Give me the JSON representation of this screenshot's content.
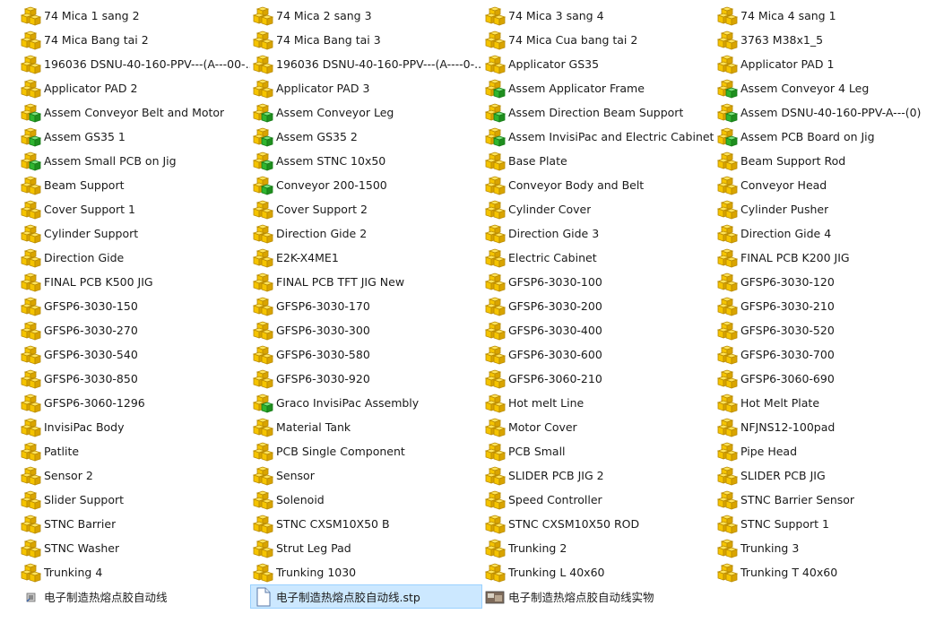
{
  "files": [
    {
      "name": "74 Mica 1 sang 2",
      "icon": "part-icon"
    },
    {
      "name": "74 Mica 2 sang 3",
      "icon": "part-icon"
    },
    {
      "name": "74 Mica 3 sang 4",
      "icon": "part-icon"
    },
    {
      "name": "74 Mica 4 sang 1",
      "icon": "part-icon"
    },
    {
      "name": "74 Mica Bang tai 2",
      "icon": "part-icon"
    },
    {
      "name": "74 Mica Bang tai 3",
      "icon": "part-icon"
    },
    {
      "name": "74 Mica Cua bang tai 2",
      "icon": "part-icon"
    },
    {
      "name": "3763 M38x1_5",
      "icon": "part-icon"
    },
    {
      "name": "196036 DSNU-40-160-PPV---(A---00-...",
      "icon": "part-icon"
    },
    {
      "name": "196036 DSNU-40-160-PPV---(A----0-...",
      "icon": "part-icon"
    },
    {
      "name": "Applicator GS35",
      "icon": "part-icon"
    },
    {
      "name": "Applicator PAD 1",
      "icon": "part-icon"
    },
    {
      "name": "Applicator PAD 2",
      "icon": "part-icon"
    },
    {
      "name": "Applicator PAD 3",
      "icon": "part-icon"
    },
    {
      "name": "Assem Applicator Frame",
      "icon": "assembly-icon"
    },
    {
      "name": "Assem Conveyor 4 Leg",
      "icon": "assembly-icon"
    },
    {
      "name": "Assem Conveyor Belt and Motor",
      "icon": "assembly-icon"
    },
    {
      "name": "Assem Conveyor Leg",
      "icon": "assembly-icon"
    },
    {
      "name": "Assem Direction Beam Support",
      "icon": "assembly-icon"
    },
    {
      "name": "Assem DSNU-40-160-PPV-A---(0)",
      "icon": "assembly-icon"
    },
    {
      "name": "Assem GS35 1",
      "icon": "assembly-icon"
    },
    {
      "name": "Assem GS35 2",
      "icon": "assembly-icon"
    },
    {
      "name": "Assem InvisiPac and Electric Cabinet",
      "icon": "assembly-icon"
    },
    {
      "name": "Assem PCB Board on Jig",
      "icon": "assembly-icon"
    },
    {
      "name": "Assem Small PCB on Jig",
      "icon": "assembly-icon"
    },
    {
      "name": "Assem STNC 10x50",
      "icon": "assembly-icon"
    },
    {
      "name": "Base Plate",
      "icon": "part-icon"
    },
    {
      "name": "Beam Support Rod",
      "icon": "part-icon"
    },
    {
      "name": "Beam Support",
      "icon": "part-icon"
    },
    {
      "name": "Conveyor 200-1500",
      "icon": "assembly-icon"
    },
    {
      "name": "Conveyor Body and Belt",
      "icon": "part-icon"
    },
    {
      "name": "Conveyor Head",
      "icon": "part-icon"
    },
    {
      "name": "Cover Support 1",
      "icon": "part-icon"
    },
    {
      "name": "Cover Support 2",
      "icon": "part-icon"
    },
    {
      "name": "Cylinder Cover",
      "icon": "part-icon"
    },
    {
      "name": "Cylinder Pusher",
      "icon": "part-icon"
    },
    {
      "name": "Cylinder Support",
      "icon": "part-icon"
    },
    {
      "name": "Direction Gide 2",
      "icon": "part-icon"
    },
    {
      "name": "Direction Gide 3",
      "icon": "part-icon"
    },
    {
      "name": "Direction Gide 4",
      "icon": "part-icon"
    },
    {
      "name": "Direction Gide",
      "icon": "part-icon"
    },
    {
      "name": "E2K-X4ME1",
      "icon": "part-icon"
    },
    {
      "name": "Electric Cabinet",
      "icon": "part-icon"
    },
    {
      "name": "FINAL PCB K200 JIG",
      "icon": "part-icon"
    },
    {
      "name": "FINAL PCB K500 JIG",
      "icon": "part-icon"
    },
    {
      "name": "FINAL PCB TFT JIG New",
      "icon": "part-icon"
    },
    {
      "name": "GFSP6-3030-100",
      "icon": "part-icon"
    },
    {
      "name": "GFSP6-3030-120",
      "icon": "part-icon"
    },
    {
      "name": "GFSP6-3030-150",
      "icon": "part-icon"
    },
    {
      "name": "GFSP6-3030-170",
      "icon": "part-icon"
    },
    {
      "name": "GFSP6-3030-200",
      "icon": "part-icon"
    },
    {
      "name": "GFSP6-3030-210",
      "icon": "part-icon"
    },
    {
      "name": "GFSP6-3030-270",
      "icon": "part-icon"
    },
    {
      "name": "GFSP6-3030-300",
      "icon": "part-icon"
    },
    {
      "name": "GFSP6-3030-400",
      "icon": "part-icon"
    },
    {
      "name": "GFSP6-3030-520",
      "icon": "part-icon"
    },
    {
      "name": "GFSP6-3030-540",
      "icon": "part-icon"
    },
    {
      "name": "GFSP6-3030-580",
      "icon": "part-icon"
    },
    {
      "name": "GFSP6-3030-600",
      "icon": "part-icon"
    },
    {
      "name": "GFSP6-3030-700",
      "icon": "part-icon"
    },
    {
      "name": "GFSP6-3030-850",
      "icon": "part-icon"
    },
    {
      "name": "GFSP6-3030-920",
      "icon": "part-icon"
    },
    {
      "name": "GFSP6-3060-210",
      "icon": "part-icon"
    },
    {
      "name": "GFSP6-3060-690",
      "icon": "part-icon"
    },
    {
      "name": "GFSP6-3060-1296",
      "icon": "part-icon"
    },
    {
      "name": "Graco InvisiPac Assembly",
      "icon": "assembly-icon"
    },
    {
      "name": "Hot melt Line",
      "icon": "part-icon"
    },
    {
      "name": "Hot Melt Plate",
      "icon": "part-icon"
    },
    {
      "name": "InvisiPac Body",
      "icon": "part-icon"
    },
    {
      "name": "Material Tank",
      "icon": "part-icon"
    },
    {
      "name": "Motor Cover",
      "icon": "part-icon"
    },
    {
      "name": "NFJNS12-100pad",
      "icon": "part-icon"
    },
    {
      "name": "Patlite",
      "icon": "part-icon"
    },
    {
      "name": "PCB Single Component",
      "icon": "part-icon"
    },
    {
      "name": "PCB Small",
      "icon": "part-icon"
    },
    {
      "name": "Pipe Head",
      "icon": "part-icon"
    },
    {
      "name": "Sensor 2",
      "icon": "part-icon"
    },
    {
      "name": "Sensor",
      "icon": "part-icon"
    },
    {
      "name": "SLIDER PCB JIG 2",
      "icon": "part-icon"
    },
    {
      "name": "SLIDER PCB JIG",
      "icon": "part-icon"
    },
    {
      "name": "Slider Support",
      "icon": "part-icon"
    },
    {
      "name": "Solenoid",
      "icon": "part-icon"
    },
    {
      "name": "Speed Controller",
      "icon": "part-icon"
    },
    {
      "name": "STNC Barrier Sensor",
      "icon": "part-icon"
    },
    {
      "name": "STNC Barrier",
      "icon": "part-icon"
    },
    {
      "name": "STNC CXSM10X50 B",
      "icon": "part-icon"
    },
    {
      "name": "STNC CXSM10X50 ROD",
      "icon": "part-icon"
    },
    {
      "name": "STNC Support 1",
      "icon": "part-icon"
    },
    {
      "name": "STNC Washer",
      "icon": "part-icon"
    },
    {
      "name": "Strut Leg Pad",
      "icon": "part-icon"
    },
    {
      "name": "Trunking 2",
      "icon": "part-icon"
    },
    {
      "name": "Trunking 3",
      "icon": "part-icon"
    },
    {
      "name": "Trunking 4",
      "icon": "part-icon"
    },
    {
      "name": "Trunking 1030",
      "icon": "part-icon"
    },
    {
      "name": "Trunking L 40x60",
      "icon": "part-icon"
    },
    {
      "name": "Trunking T 40x60",
      "icon": "part-icon"
    },
    {
      "name": "电子制造热熔点胶自动线",
      "icon": "shortcut-icon"
    },
    {
      "name": "电子制造热熔点胶自动线.stp",
      "icon": "document-icon",
      "selected": true
    },
    {
      "name": "电子制造热熔点胶自动线实物",
      "icon": "image-icon"
    }
  ],
  "colors": {
    "selection_bg": "#cce8ff",
    "selection_border": "#99d1ff",
    "part_yellow": "#f5c400",
    "assembly_green": "#2fb52f"
  }
}
